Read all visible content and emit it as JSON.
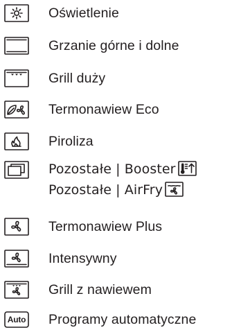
{
  "items": [
    {
      "icon": "light-icon",
      "label": "Oświetlenie"
    },
    {
      "icon": "top-bottom-heat-icon",
      "label": "Grzanie górne i dolne"
    },
    {
      "icon": "large-grill-icon",
      "label": "Grill duży"
    },
    {
      "icon": "eco-fan-icon",
      "label": "Termonawiew Eco"
    },
    {
      "icon": "pyrolysis-icon",
      "label": "Piroliza"
    },
    {
      "icon": "other-functions-icon",
      "label": "Pozostałe | Booster",
      "label2": "Pozostałe | AirFry"
    },
    {
      "icon": "fan-plus-icon",
      "label": "Termonawiew Plus"
    },
    {
      "icon": "intensive-icon",
      "label": "Intensywny"
    },
    {
      "icon": "fan-grill-icon",
      "label": "Grill z nawiewem"
    },
    {
      "icon": "auto-programs-icon",
      "label": "Programy automatyczne",
      "badge": "Auto"
    }
  ]
}
